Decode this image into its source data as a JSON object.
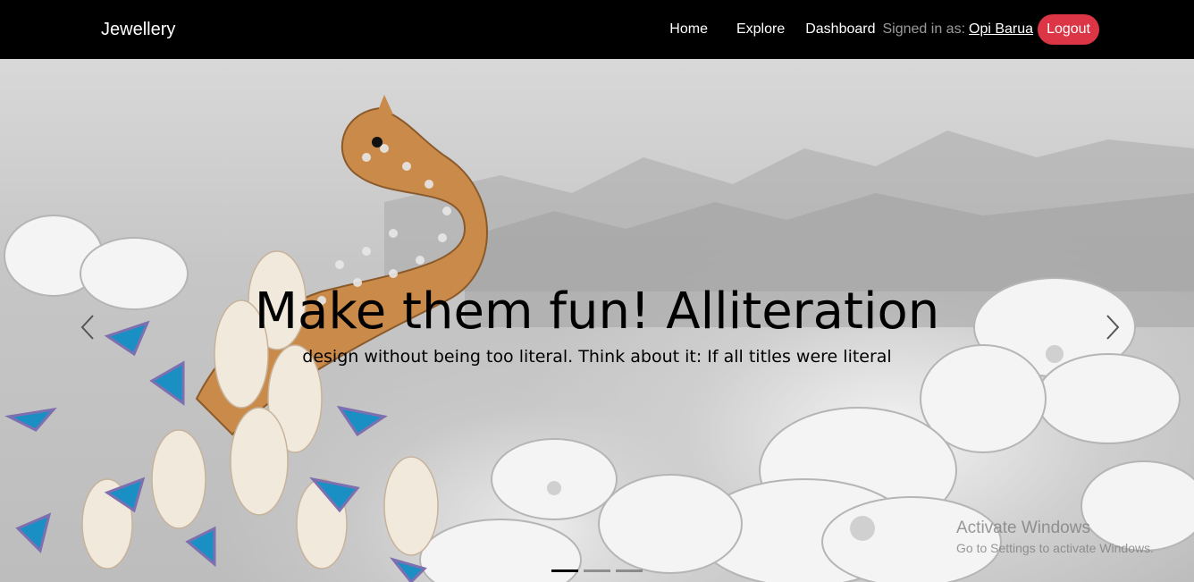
{
  "navbar": {
    "brand": "Jewellery",
    "links": {
      "home": "Home",
      "explore": "Explore",
      "dashboard": "Dashboard"
    },
    "signed_in_label": "Signed in as:",
    "user_name": "Opi Barua",
    "logout_label": "Logout"
  },
  "carousel": {
    "title": "Make them fun! Alliteration",
    "text": "design without being too literal. Think about it: If all titles were literal",
    "prev_icon": "chevron-left-icon",
    "next_icon": "chevron-right-icon",
    "indicator_count": 3,
    "active_indicator": 0
  },
  "system_watermark": {
    "title": "Activate Windows",
    "subtitle": "Go to Settings to activate Windows."
  },
  "colors": {
    "navbar_bg": "#000000",
    "logout_bg": "#dc3545",
    "jewel_gold": "#c98a4a",
    "jewel_blue": "#1a8fc4"
  }
}
